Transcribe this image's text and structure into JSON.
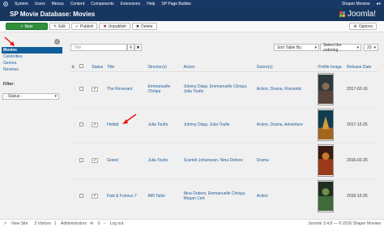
{
  "topbar": {
    "menu": [
      "System",
      "Users",
      "Menus",
      "Content",
      "Components",
      "Extensions",
      "Help",
      "SP Page Builder"
    ],
    "site_name": "Shaper Moview"
  },
  "header": {
    "title": "SP Movie Database: Movies",
    "brand": "Joomla!"
  },
  "toolbar": {
    "new_label": "New",
    "edit_label": "Edit",
    "publish_label": "Publish",
    "unpublish_label": "Unpublish",
    "delete_label": "Delete",
    "options_label": "Options"
  },
  "sidebar": {
    "items": [
      {
        "label": "Movies",
        "active": true
      },
      {
        "label": "Celebrities",
        "active": false
      },
      {
        "label": "Genres",
        "active": false
      },
      {
        "label": "Reviews",
        "active": false
      }
    ],
    "filter_title": "Filter:",
    "status_select": "- Status -"
  },
  "list_controls": {
    "search_placeholder": "Title",
    "sort_select": "Sort Table By:",
    "order_select": "Select the ordering",
    "limit_select": "20"
  },
  "table": {
    "headers": [
      "Status",
      "Title",
      "Director(s)",
      "Actors",
      "Genre(s)",
      "Profile Image",
      "Release Date"
    ],
    "rows": [
      {
        "title": "The Revenant",
        "director": "Emmanuelle Chriqui",
        "actors": "Johnny Depp, Emmanuelle Chriqui, Julia Toufis",
        "genres": "Action, Drama, Romantic",
        "release": "2017-02-16"
      },
      {
        "title": "Hobbit",
        "director": "Julia Toufis",
        "actors": "Johnny Depp, Julia Toufis",
        "genres": "Action, Drama, Adventure",
        "release": "2017-12-25"
      },
      {
        "title": "Greed",
        "director": "Julia Toufis",
        "actors": "Scarlett Johansson, Nina Dobrev",
        "genres": "Drama",
        "release": "2016-02-25"
      },
      {
        "title": "Fast & Furious 7",
        "director": "Rifil Tailor",
        "actors": "Nina Dobrev, Emmanuelle Chriqui, Megan Cert",
        "genres": "Action",
        "release": "2016-12-25"
      }
    ]
  },
  "footer": {
    "view_site": "View Site",
    "visitors": "3 Visitors",
    "administrators": "Administrators",
    "messages": "0",
    "logout": "Log out",
    "version": "Joomla! 3.4.8 — © 2016 Shaper Moview"
  },
  "colors": {
    "topbar": "#1a3867",
    "header": "#17365e",
    "new_button": "#2f8f3b",
    "link": "#1f5c99",
    "sidebar_active": "#0f5d9a"
  }
}
